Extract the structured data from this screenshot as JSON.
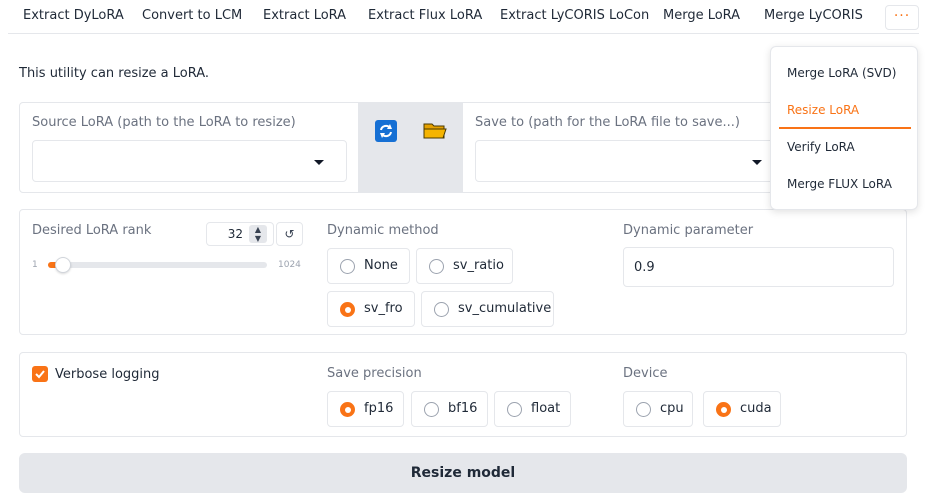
{
  "tabs": [
    {
      "label": "Extract DyLoRA"
    },
    {
      "label": "Convert to LCM"
    },
    {
      "label": "Extract LoRA"
    },
    {
      "label": "Extract Flux LoRA"
    },
    {
      "label": "Extract LyCORIS LoCon"
    },
    {
      "label": "Merge LoRA"
    },
    {
      "label": "Merge LyCORIS"
    }
  ],
  "more_label": "···",
  "overflow_menu": [
    {
      "label": "Merge LoRA (SVD)",
      "active": false
    },
    {
      "label": "Resize LoRA",
      "active": true
    },
    {
      "label": "Verify LoRA",
      "active": false
    },
    {
      "label": "Merge FLUX LoRA",
      "active": false
    }
  ],
  "description": "This utility can resize a LoRA.",
  "source": {
    "label": "Source LoRA (path to the LoRA to resize)",
    "value": "",
    "refresh_icon": "refresh-icon",
    "folder_icon": "folder-icon"
  },
  "save_to": {
    "label": "Save to (path for the LoRA file to save...)",
    "value": ""
  },
  "rank": {
    "label": "Desired LoRA rank",
    "value": "32",
    "min": "1",
    "max": "1024",
    "reset_icon": "↺"
  },
  "dynamic_method": {
    "label": "Dynamic method",
    "options": [
      "None",
      "sv_ratio",
      "sv_fro",
      "sv_cumulative"
    ],
    "selected": "sv_fro"
  },
  "dynamic_parameter": {
    "label": "Dynamic parameter",
    "value": "0.9"
  },
  "verbose": {
    "label": "Verbose logging",
    "checked": true
  },
  "save_precision": {
    "label": "Save precision",
    "options": [
      "fp16",
      "bf16",
      "float"
    ],
    "selected": "fp16"
  },
  "device": {
    "label": "Device",
    "options": [
      "cpu",
      "cuda"
    ],
    "selected": "cuda"
  },
  "resize_button": "Resize model",
  "colors": {
    "accent": "#f97316",
    "border": "#e5e7eb",
    "refresh_blue": "#1670d4",
    "folder_yellow": "#f5b400"
  }
}
